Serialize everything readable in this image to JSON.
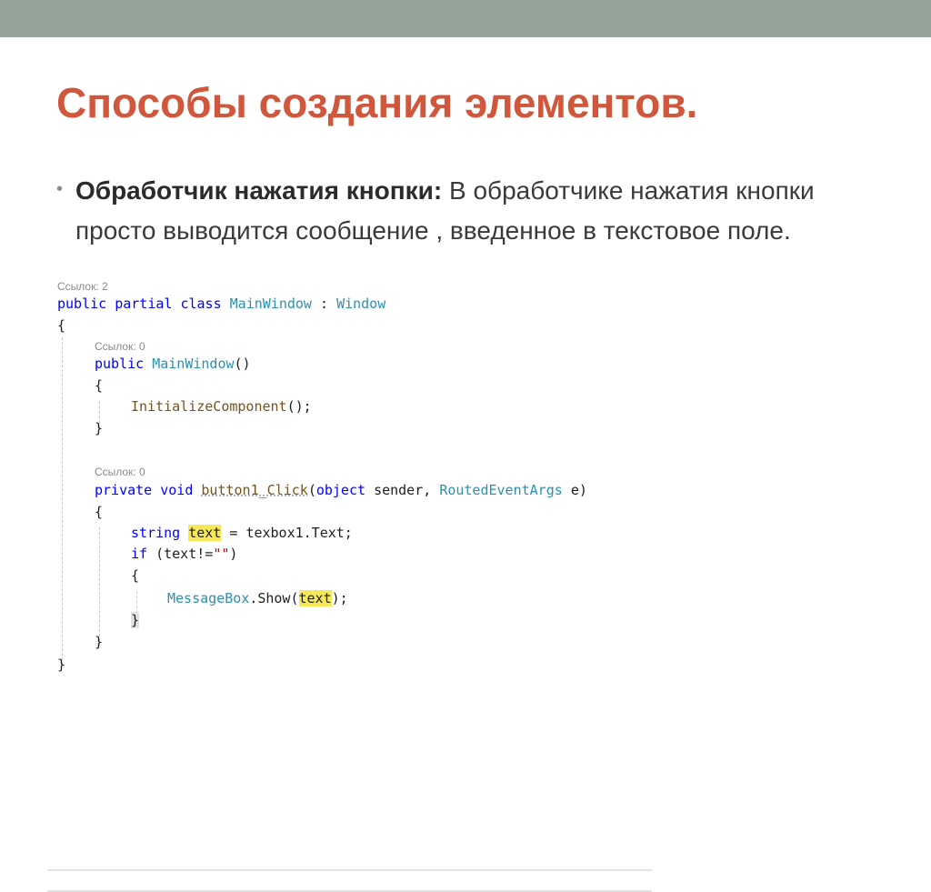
{
  "slide": {
    "title": "Способы создания элементов.",
    "bullet": {
      "bold": "Обработчик нажатия кнопки:",
      "text": " В обработчике нажатия кнопки просто выводится сообщение , введенное в текстовое поле."
    }
  },
  "code": {
    "lens_class": "Ссылок: 2",
    "lens_ctor": "Ссылок: 0",
    "lens_click": "Ссылок: 0",
    "tokens": {
      "public": "public",
      "partial": "partial",
      "class": "class",
      "MainWindow": "MainWindow",
      "colon": ":",
      "Window": "Window",
      "open_brace": "{",
      "close_brace": "}",
      "ctor_parens": "()",
      "InitializeComponent": "InitializeComponent",
      "call_end": "();",
      "private": "private",
      "void": "void",
      "button1_Click": "button1_Click",
      "paren_open": "(",
      "object": "object",
      "sender": "sender,",
      "RoutedEventArgs": "RoutedEventArgs",
      "e_close": "e)",
      "string": "string",
      "text": "text",
      "assign": "=",
      "texbox1": "texbox1.Text;",
      "if": "if",
      "cond_open": "(text!=",
      "empty_str": "\"\"",
      "paren_close": ")",
      "MessageBox": "MessageBox",
      "dot_show": ".Show(",
      "end_call": ");"
    }
  },
  "colors": {
    "title": "#d0573c",
    "top_bar": "#95a39a",
    "keyword": "#0000ff",
    "type": "#2b91af",
    "method": "#74531f",
    "highlight": "#f7e857"
  }
}
